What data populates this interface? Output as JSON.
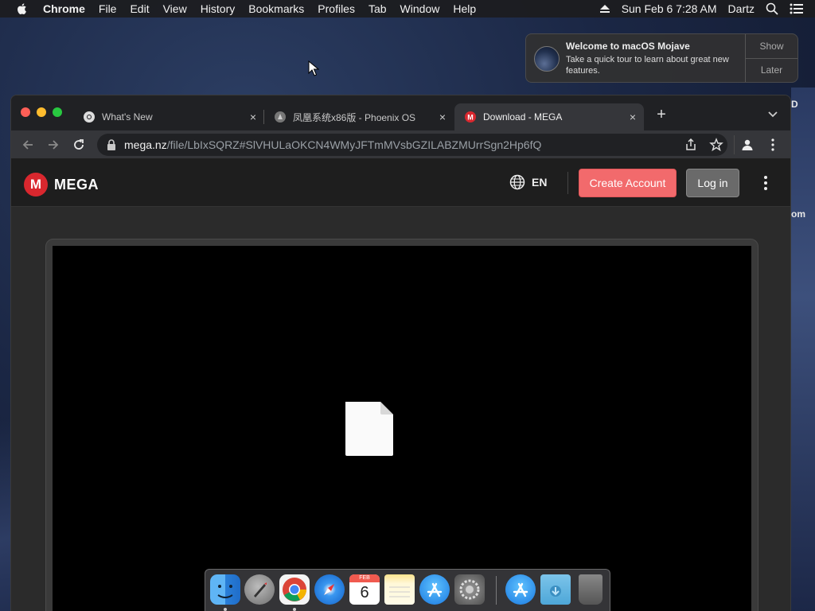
{
  "menubar": {
    "app_name": "Chrome",
    "items": [
      "File",
      "Edit",
      "View",
      "History",
      "Bookmarks",
      "Profiles",
      "Tab",
      "Window",
      "Help"
    ],
    "clock": "Sun Feb 6  7:28 AM",
    "user": "Dartz"
  },
  "desktop": {
    "edge_text_1": "D",
    "edge_text_2": "om"
  },
  "notification": {
    "title": "Welcome to macOS Mojave",
    "body": "Take a quick tour to learn about great new features.",
    "show_label": "Show",
    "later_label": "Later"
  },
  "browser": {
    "tabs": [
      {
        "title": "What's New",
        "active": false
      },
      {
        "title": "凤凰系统x86版 - Phoenix OS",
        "active": false
      },
      {
        "title": "Download - MEGA",
        "active": true
      }
    ],
    "url_domain": "mega.nz",
    "url_path": "/file/LbIxSQRZ#SlVHULaOKCN4WMyJFTmMVsbGZILABZMUrrSgn2Hp6fQ"
  },
  "mega": {
    "logo_letter": "M",
    "logo_text": "MEGA",
    "language": "EN",
    "create_account": "Create Account",
    "login": "Log in"
  },
  "dock": {
    "calendar_month": "FEB",
    "calendar_day": "6"
  },
  "colors": {
    "mega_red": "#d9272e",
    "create_button": "#f26a6c",
    "login_button": "#6a6a6a"
  }
}
